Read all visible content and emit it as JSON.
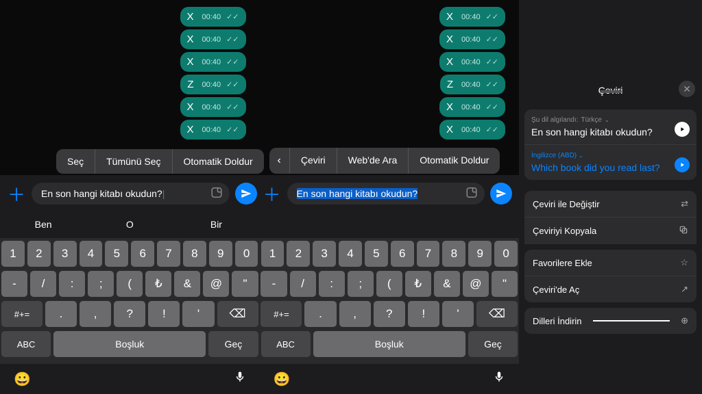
{
  "chat": {
    "messages": [
      {
        "letter": "X",
        "time": "00:40"
      },
      {
        "letter": "X",
        "time": "00:40"
      },
      {
        "letter": "X",
        "time": "00:40"
      },
      {
        "letter": "Z",
        "time": "00:40"
      },
      {
        "letter": "X",
        "time": "00:40"
      },
      {
        "letter": "X",
        "time": "00:40"
      }
    ]
  },
  "context_menu_left": {
    "select": "Seç",
    "select_all": "Tümünü Seç",
    "autofill": "Otomatik Doldur"
  },
  "context_menu_right": {
    "translate": "Çeviri",
    "web_search": "Web'de Ara",
    "autofill": "Otomatik Doldur"
  },
  "input": {
    "text": "En son hangi kitabı okudun?"
  },
  "suggestions": {
    "a": "Ben",
    "b": "O",
    "c": "Bir"
  },
  "keyboard": {
    "row1": [
      "1",
      "2",
      "3",
      "4",
      "5",
      "6",
      "7",
      "8",
      "9",
      "0"
    ],
    "row2": [
      "-",
      "/",
      ":",
      ";",
      "(",
      "₺",
      "&",
      "@",
      "\""
    ],
    "row3_shift": "#+=",
    "row3": [
      ".",
      ",",
      "?",
      "!",
      "'"
    ],
    "abc": "ABC",
    "space": "Boşluk",
    "go": "Geç"
  },
  "translate_panel": {
    "title": "Çeviri",
    "detected_prefix": "Şu dil algılandı:",
    "detected_lang": "Türkçe",
    "source_text": "En son hangi kitabı okudun?",
    "target_lang": "İngilizce (ABD)",
    "target_text": "Which book did you read last?",
    "actions": {
      "replace": "Çeviri ile Değiştir",
      "copy": "Çeviriyi Kopyala",
      "favorite": "Favorilere Ekle",
      "open": "Çeviri'de Aç",
      "download": "Dilleri İndirin"
    }
  }
}
